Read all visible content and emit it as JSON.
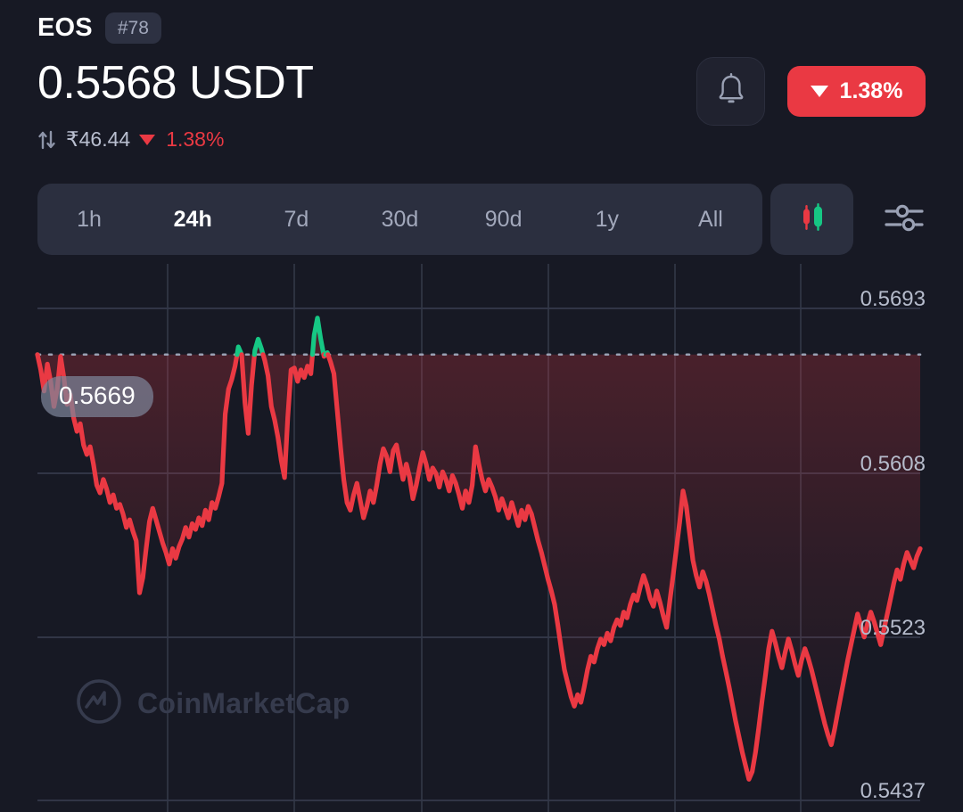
{
  "header": {
    "symbol": "EOS",
    "rank": "#78",
    "price": "0.5568 USDT",
    "fiat_price": "₹46.44",
    "change_pct_small": "1.38%",
    "change_pct_badge": "1.38%",
    "change_direction": "down",
    "swap_icon": "swap-vertical-icon",
    "bell_icon": "bell-icon",
    "accent_red": "#ea3943",
    "accent_green": "#16c784"
  },
  "toolbar": {
    "ranges": [
      {
        "label": "1h",
        "active": false
      },
      {
        "label": "24h",
        "active": true
      },
      {
        "label": "7d",
        "active": false
      },
      {
        "label": "30d",
        "active": false
      },
      {
        "label": "90d",
        "active": false
      },
      {
        "label": "1y",
        "active": false
      },
      {
        "label": "All",
        "active": false
      }
    ],
    "candle_toggle_icon": "candlestick-icon",
    "settings_icon": "sliders-icon"
  },
  "chart_data": {
    "type": "line",
    "title": "",
    "xlabel": "",
    "ylabel": "",
    "ylim": [
      0.5437,
      0.5693
    ],
    "grid": true,
    "legend": null,
    "y_ticks": [
      "0.5693",
      "0.5608",
      "0.5523",
      "0.5437"
    ],
    "y_tick_values": [
      0.5693,
      0.5608,
      0.5523,
      0.5437
    ],
    "reference_line": {
      "value": 0.5669,
      "label": "0.5669",
      "style": "dotted"
    },
    "line_color_down": "#ea3943",
    "line_color_up": "#16c784",
    "current_price": 0.5568,
    "watermark": "CoinMarketCap",
    "values": [
      0.5669,
      0.5661,
      0.565,
      0.5664,
      0.5655,
      0.5642,
      0.5651,
      0.5668,
      0.5657,
      0.5643,
      0.5648,
      0.5636,
      0.5629,
      0.5633,
      0.5622,
      0.5617,
      0.5621,
      0.5612,
      0.5601,
      0.5597,
      0.5604,
      0.5599,
      0.5592,
      0.5596,
      0.5589,
      0.5591,
      0.5586,
      0.5579,
      0.5583,
      0.5577,
      0.5572,
      0.5545,
      0.5553,
      0.5568,
      0.5582,
      0.5589,
      0.5583,
      0.5577,
      0.5571,
      0.5566,
      0.556,
      0.5568,
      0.5563,
      0.5569,
      0.5573,
      0.5579,
      0.5574,
      0.5581,
      0.5578,
      0.5584,
      0.558,
      0.5588,
      0.5583,
      0.5592,
      0.5589,
      0.5595,
      0.5602,
      0.5638,
      0.5651,
      0.5656,
      0.5663,
      0.5673,
      0.5669,
      0.5644,
      0.5628,
      0.5653,
      0.5671,
      0.5677,
      0.5672,
      0.5666,
      0.5658,
      0.5642,
      0.5635,
      0.5626,
      0.5614,
      0.5605,
      0.5636,
      0.5661,
      0.5662,
      0.5655,
      0.5661,
      0.5657,
      0.5663,
      0.5659,
      0.5679,
      0.5688,
      0.5677,
      0.5668,
      0.567,
      0.5665,
      0.5659,
      0.564,
      0.5621,
      0.5604,
      0.5592,
      0.5588,
      0.5596,
      0.5602,
      0.5593,
      0.5584,
      0.559,
      0.5598,
      0.5592,
      0.5601,
      0.5612,
      0.562,
      0.5616,
      0.5608,
      0.5619,
      0.5622,
      0.5613,
      0.5604,
      0.5612,
      0.5605,
      0.5594,
      0.5601,
      0.561,
      0.5618,
      0.5612,
      0.5604,
      0.561,
      0.5607,
      0.56,
      0.5608,
      0.5604,
      0.5598,
      0.5606,
      0.5602,
      0.5596,
      0.5589,
      0.5598,
      0.5592,
      0.5601,
      0.5621,
      0.5612,
      0.5604,
      0.5598,
      0.5604,
      0.56,
      0.5595,
      0.5588,
      0.5594,
      0.5589,
      0.5584,
      0.5592,
      0.5586,
      0.558,
      0.5588,
      0.5583,
      0.559,
      0.5586,
      0.5579,
      0.5572,
      0.5566,
      0.5559,
      0.5552,
      0.5546,
      0.5539,
      0.5528,
      0.5516,
      0.5505,
      0.5498,
      0.5491,
      0.5486,
      0.5492,
      0.5488,
      0.5496,
      0.5505,
      0.5512,
      0.5509,
      0.5516,
      0.5521,
      0.5518,
      0.5524,
      0.552,
      0.5527,
      0.5531,
      0.5528,
      0.5535,
      0.5532,
      0.5539,
      0.5544,
      0.5541,
      0.5548,
      0.5554,
      0.5549,
      0.5542,
      0.5538,
      0.5546,
      0.554,
      0.5533,
      0.5527,
      0.5541,
      0.5554,
      0.5568,
      0.5582,
      0.5598,
      0.559,
      0.5576,
      0.5562,
      0.5554,
      0.5548,
      0.5556,
      0.5551,
      0.5544,
      0.5536,
      0.5528,
      0.5521,
      0.5512,
      0.5504,
      0.5496,
      0.5487,
      0.5478,
      0.547,
      0.5462,
      0.5455,
      0.5448,
      0.5452,
      0.5462,
      0.5475,
      0.5489,
      0.5502,
      0.5516,
      0.5525,
      0.5519,
      0.5512,
      0.5506,
      0.5514,
      0.5521,
      0.5515,
      0.5508,
      0.5502,
      0.551,
      0.5516,
      0.5511,
      0.5505,
      0.5498,
      0.5491,
      0.5484,
      0.5477,
      0.5471,
      0.5466,
      0.5474,
      0.5483,
      0.5492,
      0.5501,
      0.551,
      0.5518,
      0.5526,
      0.5534,
      0.5528,
      0.5522,
      0.5529,
      0.5535,
      0.553,
      0.5524,
      0.5518,
      0.5526,
      0.5534,
      0.5542,
      0.555,
      0.5557,
      0.5552,
      0.556,
      0.5566,
      0.5562,
      0.5558,
      0.5564,
      0.5568
    ]
  }
}
